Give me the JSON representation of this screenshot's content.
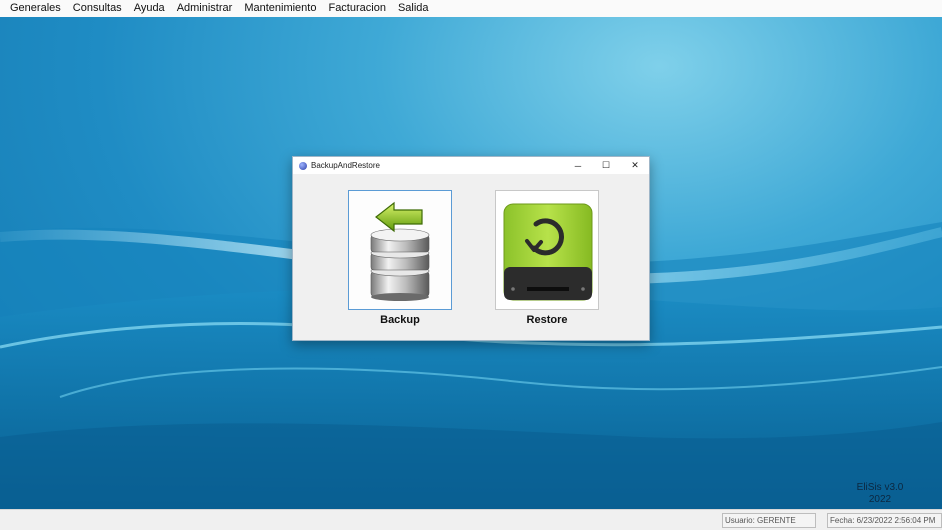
{
  "menubar": {
    "items": [
      {
        "label": "Generales"
      },
      {
        "label": "Consultas"
      },
      {
        "label": "Ayuda"
      },
      {
        "label": "Administrar"
      },
      {
        "label": "Mantenimiento"
      },
      {
        "label": "Facturacion"
      },
      {
        "label": "Salida"
      }
    ]
  },
  "dialog": {
    "title": "BackupAndRestore",
    "icon": "app-globe-icon",
    "controls": {
      "minimize": "─",
      "maximize": "☐",
      "close": "✕"
    },
    "backup": {
      "label": "Backup",
      "icon": "database-backup-icon",
      "selected": true
    },
    "restore": {
      "label": "Restore",
      "icon": "drive-restore-icon",
      "selected": false
    }
  },
  "brand": {
    "line1": "EliSis v3.0",
    "line2": "2022"
  },
  "status": {
    "usuario": "Usuario: GERENTE",
    "fecha": "Fecha: 6/23/2022 2:56:04 PM"
  },
  "colors": {
    "desktop": "#1f8cc4",
    "restore_drive": "#a6d53a",
    "backup_arrow": "#8bc21a",
    "selection_border": "#5b9bd5"
  }
}
